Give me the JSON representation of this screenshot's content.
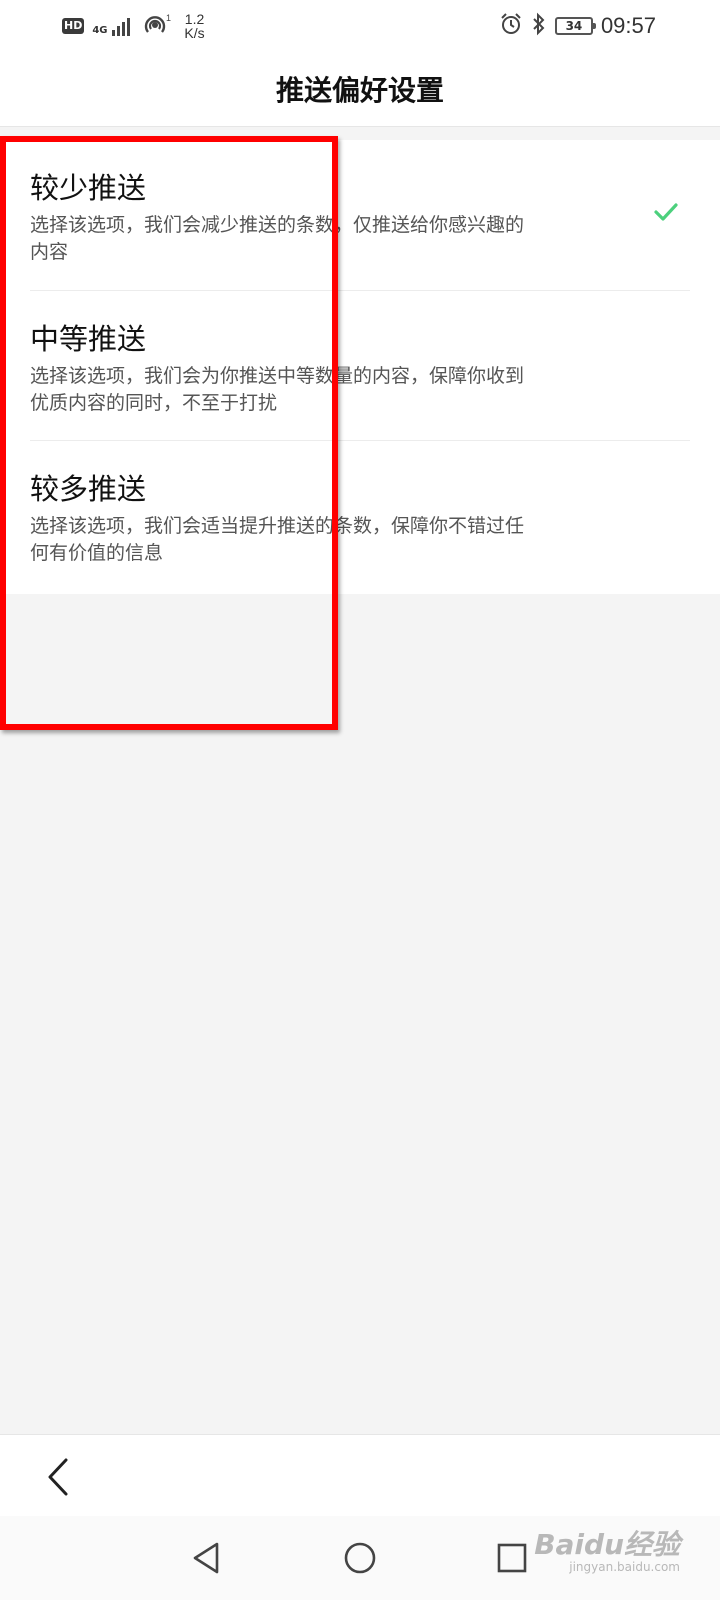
{
  "status_bar": {
    "hd": "HD",
    "network": "4G",
    "speed_value": "1.2",
    "speed_unit": "K/s",
    "battery": "34",
    "time": "09:57",
    "icons": [
      "signal-icon",
      "hotspot-icon",
      "alarm-icon",
      "bluetooth-icon",
      "battery-icon"
    ]
  },
  "header": {
    "title": "推送偏好设置"
  },
  "options": [
    {
      "title": "较少推送",
      "description": "选择该选项，我们会减少推送的条数，仅推送给你感兴趣的内容",
      "selected": true
    },
    {
      "title": "中等推送",
      "description": "选择该选项，我们会为你推送中等数量的内容，保障你收到优质内容的同时，不至于打扰",
      "selected": false
    },
    {
      "title": "较多推送",
      "description": "选择该选项，我们会适当提升推送的条数，保障你不错过任何有价值的信息",
      "selected": false
    }
  ],
  "colors": {
    "check": "#4cd07d",
    "highlight": "#ff0000",
    "background": "#f4f4f4"
  },
  "watermark": {
    "brand": "Baidu经验",
    "site": "jingyan.baidu.com"
  }
}
